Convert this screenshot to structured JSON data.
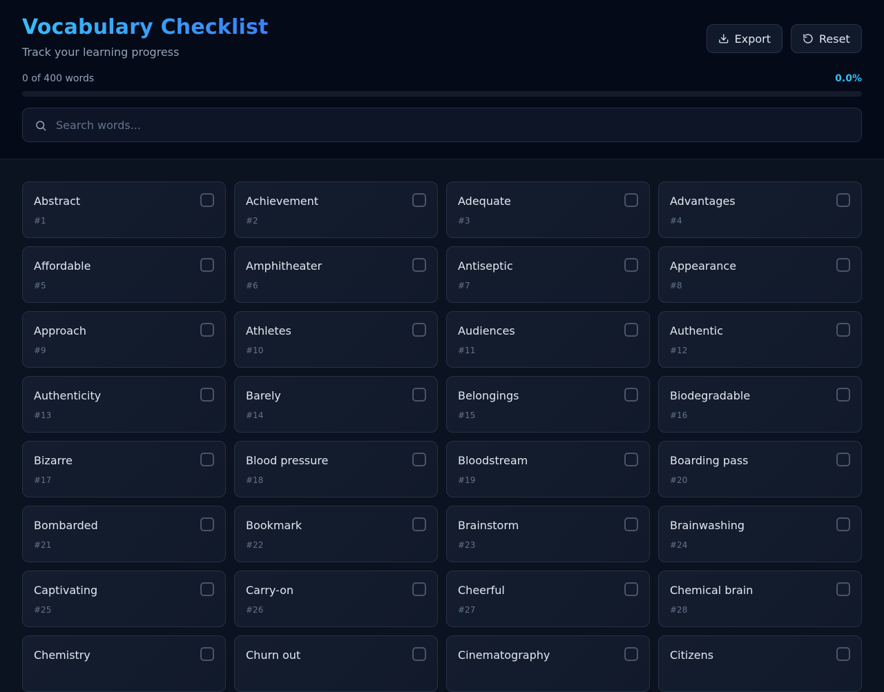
{
  "header": {
    "title": "Vocabulary Checklist",
    "subtitle": "Track your learning progress",
    "export_label": "Export",
    "reset_label": "Reset"
  },
  "progress": {
    "label": "0 of 400 words",
    "percent_label": "0.0%",
    "fraction": 0.0
  },
  "search": {
    "placeholder": "Search words...",
    "value": ""
  },
  "colors": {
    "accent": "#38bdf8",
    "background": "#0b1220",
    "card": "#141d2e"
  },
  "words": [
    {
      "word": "Abstract",
      "num": "#1"
    },
    {
      "word": "Achievement",
      "num": "#2"
    },
    {
      "word": "Adequate",
      "num": "#3"
    },
    {
      "word": "Advantages",
      "num": "#4"
    },
    {
      "word": "Affordable",
      "num": "#5"
    },
    {
      "word": "Amphitheater",
      "num": "#6"
    },
    {
      "word": "Antiseptic",
      "num": "#7"
    },
    {
      "word": "Appearance",
      "num": "#8"
    },
    {
      "word": "Approach",
      "num": "#9"
    },
    {
      "word": "Athletes",
      "num": "#10"
    },
    {
      "word": "Audiences",
      "num": "#11"
    },
    {
      "word": "Authentic",
      "num": "#12"
    },
    {
      "word": "Authenticity",
      "num": "#13"
    },
    {
      "word": "Barely",
      "num": "#14"
    },
    {
      "word": "Belongings",
      "num": "#15"
    },
    {
      "word": "Biodegradable",
      "num": "#16"
    },
    {
      "word": "Bizarre",
      "num": "#17"
    },
    {
      "word": "Blood pressure",
      "num": "#18"
    },
    {
      "word": "Bloodstream",
      "num": "#19"
    },
    {
      "word": "Boarding pass",
      "num": "#20"
    },
    {
      "word": "Bombarded",
      "num": "#21"
    },
    {
      "word": "Bookmark",
      "num": "#22"
    },
    {
      "word": "Brainstorm",
      "num": "#23"
    },
    {
      "word": "Brainwashing",
      "num": "#24"
    },
    {
      "word": "Captivating",
      "num": "#25"
    },
    {
      "word": "Carry-on",
      "num": "#26"
    },
    {
      "word": "Cheerful",
      "num": "#27"
    },
    {
      "word": "Chemical brain",
      "num": "#28"
    },
    {
      "word": "Chemistry",
      "num": ""
    },
    {
      "word": "Churn out",
      "num": ""
    },
    {
      "word": "Cinematography",
      "num": ""
    },
    {
      "word": "Citizens",
      "num": ""
    }
  ]
}
